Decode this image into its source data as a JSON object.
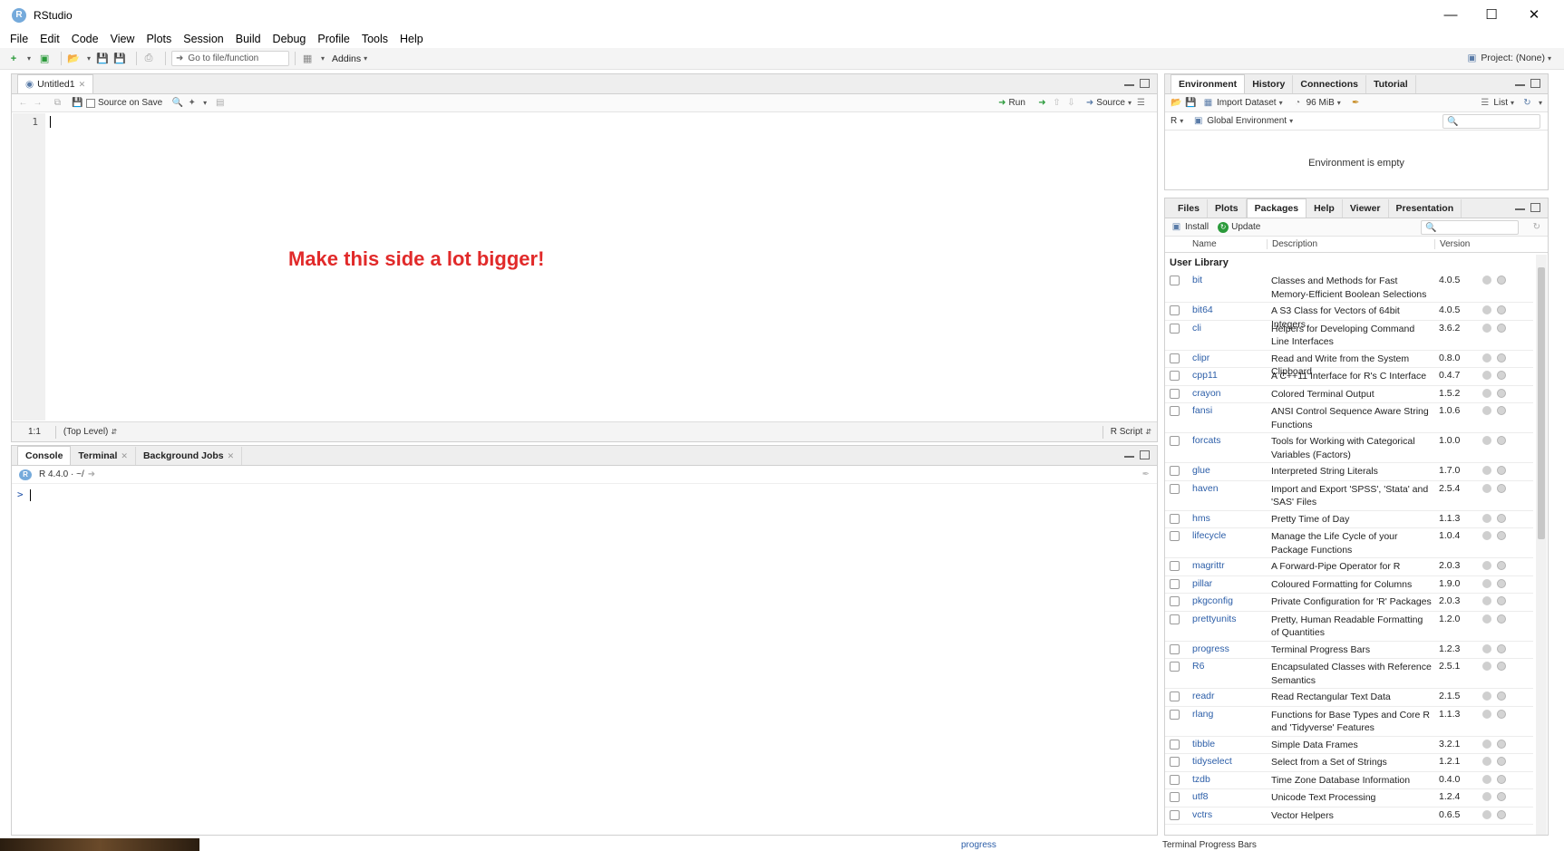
{
  "window": {
    "title": "RStudio",
    "logo": "R"
  },
  "menu": [
    "File",
    "Edit",
    "Code",
    "View",
    "Plots",
    "Session",
    "Build",
    "Debug",
    "Profile",
    "Tools",
    "Help"
  ],
  "toolbar": {
    "goto_placeholder": "Go to file/function",
    "addins": "Addins",
    "project": "Project: (None)"
  },
  "editor": {
    "tab": "Untitled1",
    "source_on_save": "Source on Save",
    "run": "Run",
    "source": "Source",
    "line_number": "1",
    "annotation": "Make this side a lot bigger!",
    "cursor_pos": "1:1",
    "scope": "(Top Level)",
    "file_type": "R Script"
  },
  "console": {
    "tabs": [
      "Console",
      "Terminal",
      "Background Jobs"
    ],
    "version": "R 4.4.0 · ~/",
    "prompt": ">"
  },
  "environment": {
    "tabs": [
      "Environment",
      "History",
      "Connections",
      "Tutorial"
    ],
    "import_dataset": "Import Dataset",
    "memory": "96 MiB",
    "view_mode": "List",
    "language": "R",
    "scope": "Global Environment",
    "empty_message": "Environment is empty"
  },
  "files": {
    "tabs": [
      "Files",
      "Plots",
      "Packages",
      "Help",
      "Viewer",
      "Presentation"
    ],
    "install": "Install",
    "update": "Update",
    "columns": {
      "name": "Name",
      "description": "Description",
      "version": "Version"
    },
    "section": "User Library",
    "packages": [
      {
        "name": "bit",
        "description": "Classes and Methods for Fast Memory-Efficient Boolean Selections",
        "version": "4.0.5"
      },
      {
        "name": "bit64",
        "description": "A S3 Class for Vectors of 64bit Integers",
        "version": "4.0.5"
      },
      {
        "name": "cli",
        "description": "Helpers for Developing Command Line Interfaces",
        "version": "3.6.2"
      },
      {
        "name": "clipr",
        "description": "Read and Write from the System Clipboard",
        "version": "0.8.0"
      },
      {
        "name": "cpp11",
        "description": "A C++11 Interface for R's C Interface",
        "version": "0.4.7"
      },
      {
        "name": "crayon",
        "description": "Colored Terminal Output",
        "version": "1.5.2"
      },
      {
        "name": "fansi",
        "description": "ANSI Control Sequence Aware String Functions",
        "version": "1.0.6"
      },
      {
        "name": "forcats",
        "description": "Tools for Working with Categorical Variables (Factors)",
        "version": "1.0.0"
      },
      {
        "name": "glue",
        "description": "Interpreted String Literals",
        "version": "1.7.0"
      },
      {
        "name": "haven",
        "description": "Import and Export 'SPSS', 'Stata' and 'SAS' Files",
        "version": "2.5.4"
      },
      {
        "name": "hms",
        "description": "Pretty Time of Day",
        "version": "1.1.3"
      },
      {
        "name": "lifecycle",
        "description": "Manage the Life Cycle of your Package Functions",
        "version": "1.0.4"
      },
      {
        "name": "magrittr",
        "description": "A Forward-Pipe Operator for R",
        "version": "2.0.3"
      },
      {
        "name": "pillar",
        "description": "Coloured Formatting for Columns",
        "version": "1.9.0"
      },
      {
        "name": "pkgconfig",
        "description": "Private Configuration for 'R' Packages",
        "version": "2.0.3"
      },
      {
        "name": "prettyunits",
        "description": "Pretty, Human Readable Formatting of Quantities",
        "version": "1.2.0"
      },
      {
        "name": "progress",
        "description": "Terminal Progress Bars",
        "version": "1.2.3"
      },
      {
        "name": "R6",
        "description": "Encapsulated Classes with Reference Semantics",
        "version": "2.5.1"
      },
      {
        "name": "readr",
        "description": "Read Rectangular Text Data",
        "version": "2.1.5"
      },
      {
        "name": "rlang",
        "description": "Functions for Base Types and Core R and 'Tidyverse' Features",
        "version": "1.1.3"
      },
      {
        "name": "tibble",
        "description": "Simple Data Frames",
        "version": "3.2.1"
      },
      {
        "name": "tidyselect",
        "description": "Select from a Set of Strings",
        "version": "1.2.1"
      },
      {
        "name": "tzdb",
        "description": "Time Zone Database Information",
        "version": "0.4.0"
      },
      {
        "name": "utf8",
        "description": "Unicode Text Processing",
        "version": "1.2.4"
      },
      {
        "name": "vctrs",
        "description": "Vector Helpers",
        "version": "0.6.5"
      }
    ]
  },
  "background": {
    "name": "progress",
    "description": "Terminal Progress Bars"
  },
  "colors": {
    "annotation": "#e12a2a",
    "link": "#2c5ea8",
    "r_blue": "#75aadb"
  }
}
